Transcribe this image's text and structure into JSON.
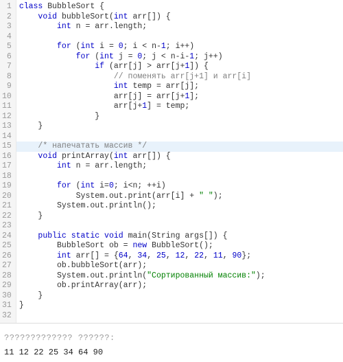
{
  "lines": [
    {
      "n": 1,
      "hl": false,
      "tokens": [
        [
          "",
          "class ",
          "kw"
        ],
        [
          "",
          "BubbleSort ",
          ""
        ],
        [
          "",
          "{",
          ""
        ]
      ]
    },
    {
      "n": 2,
      "hl": false,
      "tokens": [
        [
          "    ",
          "void ",
          "kw"
        ],
        [
          "",
          "bubbleSort",
          ""
        ],
        [
          "",
          "(",
          ""
        ],
        [
          "",
          "int ",
          "type"
        ],
        [
          "",
          "arr[]) {",
          ""
        ]
      ]
    },
    {
      "n": 3,
      "hl": false,
      "tokens": [
        [
          "        ",
          "int ",
          "type"
        ],
        [
          "",
          "n = arr.length;",
          ""
        ]
      ]
    },
    {
      "n": 4,
      "hl": false,
      "tokens": [
        [
          "",
          "",
          ""
        ]
      ]
    },
    {
      "n": 5,
      "hl": false,
      "tokens": [
        [
          "        ",
          "for ",
          "kw"
        ],
        [
          "",
          "(",
          ""
        ],
        [
          "",
          "int ",
          "type"
        ],
        [
          "",
          "i = ",
          ""
        ],
        [
          "",
          "0",
          "num"
        ],
        [
          "",
          "; i < n-",
          ""
        ],
        [
          "",
          "1",
          "num"
        ],
        [
          "",
          "; i++)",
          ""
        ]
      ]
    },
    {
      "n": 6,
      "hl": false,
      "tokens": [
        [
          "            ",
          "for ",
          "kw"
        ],
        [
          "",
          "(",
          ""
        ],
        [
          "",
          "int ",
          "type"
        ],
        [
          "",
          "j = ",
          ""
        ],
        [
          "",
          "0",
          "num"
        ],
        [
          "",
          "; j < n-i-",
          ""
        ],
        [
          "",
          "1",
          "num"
        ],
        [
          "",
          "; j++)",
          ""
        ]
      ]
    },
    {
      "n": 7,
      "hl": false,
      "tokens": [
        [
          "                ",
          "if ",
          "kw"
        ],
        [
          "",
          "(arr[j] > arr[j+",
          ""
        ],
        [
          "",
          "1",
          "num"
        ],
        [
          "",
          "]) {",
          ""
        ]
      ]
    },
    {
      "n": 8,
      "hl": false,
      "tokens": [
        [
          "                    ",
          "// поменять arr[j+1] и arr[i]",
          "com"
        ]
      ]
    },
    {
      "n": 9,
      "hl": false,
      "tokens": [
        [
          "                    ",
          "int ",
          "type"
        ],
        [
          "",
          "temp = arr[j];",
          ""
        ]
      ]
    },
    {
      "n": 10,
      "hl": false,
      "tokens": [
        [
          "                    ",
          "arr[j] = arr[j+",
          ""
        ],
        [
          "",
          "1",
          "num"
        ],
        [
          "",
          "];",
          ""
        ]
      ]
    },
    {
      "n": 11,
      "hl": false,
      "tokens": [
        [
          "                    ",
          "arr[j+",
          ""
        ],
        [
          "",
          "1",
          "num"
        ],
        [
          "",
          "] = temp;",
          ""
        ]
      ]
    },
    {
      "n": 12,
      "hl": false,
      "tokens": [
        [
          "                ",
          "}",
          ""
        ]
      ]
    },
    {
      "n": 13,
      "hl": false,
      "tokens": [
        [
          "    ",
          "}",
          ""
        ]
      ]
    },
    {
      "n": 14,
      "hl": false,
      "tokens": [
        [
          "",
          "",
          ""
        ]
      ]
    },
    {
      "n": 15,
      "hl": true,
      "tokens": [
        [
          "    ",
          "/* напечатать массив */",
          "com"
        ]
      ]
    },
    {
      "n": 16,
      "hl": false,
      "tokens": [
        [
          "    ",
          "void ",
          "kw"
        ],
        [
          "",
          "printArray",
          ""
        ],
        [
          "",
          "(",
          ""
        ],
        [
          "",
          "int ",
          "type"
        ],
        [
          "",
          "arr[]) {",
          ""
        ]
      ]
    },
    {
      "n": 17,
      "hl": false,
      "tokens": [
        [
          "        ",
          "int ",
          "type"
        ],
        [
          "",
          "n = arr.length;",
          ""
        ]
      ]
    },
    {
      "n": 18,
      "hl": false,
      "tokens": [
        [
          "",
          "",
          ""
        ]
      ]
    },
    {
      "n": 19,
      "hl": false,
      "tokens": [
        [
          "        ",
          "for ",
          "kw"
        ],
        [
          "",
          "(",
          ""
        ],
        [
          "",
          "int ",
          "type"
        ],
        [
          "",
          "i=",
          ""
        ],
        [
          "",
          "0",
          "num"
        ],
        [
          "",
          "; i<n; ++i)",
          ""
        ]
      ]
    },
    {
      "n": 20,
      "hl": false,
      "tokens": [
        [
          "            ",
          "System.out.print(arr[i] + ",
          ""
        ],
        [
          "",
          "\" \"",
          "str"
        ],
        [
          "",
          ");",
          ""
        ]
      ]
    },
    {
      "n": 21,
      "hl": false,
      "tokens": [
        [
          "        ",
          "System.out.println();",
          ""
        ]
      ]
    },
    {
      "n": 22,
      "hl": false,
      "tokens": [
        [
          "    ",
          "}",
          ""
        ]
      ]
    },
    {
      "n": 23,
      "hl": false,
      "tokens": [
        [
          "",
          "",
          ""
        ]
      ]
    },
    {
      "n": 24,
      "hl": false,
      "tokens": [
        [
          "    ",
          "public static ",
          "kw"
        ],
        [
          "",
          "void ",
          "kw"
        ],
        [
          "",
          "main",
          ""
        ],
        [
          "",
          "(String args[]) {",
          ""
        ]
      ]
    },
    {
      "n": 25,
      "hl": false,
      "tokens": [
        [
          "        ",
          "BubbleSort ob = ",
          ""
        ],
        [
          "",
          "new ",
          "kw"
        ],
        [
          "",
          "BubbleSort();",
          ""
        ]
      ]
    },
    {
      "n": 26,
      "hl": false,
      "tokens": [
        [
          "        ",
          "int ",
          "type"
        ],
        [
          "",
          "arr[] = {",
          ""
        ],
        [
          "",
          "64",
          "num"
        ],
        [
          "",
          ", ",
          ""
        ],
        [
          "",
          "34",
          "num"
        ],
        [
          "",
          ", ",
          ""
        ],
        [
          "",
          "25",
          "num"
        ],
        [
          "",
          ", ",
          ""
        ],
        [
          "",
          "12",
          "num"
        ],
        [
          "",
          ", ",
          ""
        ],
        [
          "",
          "22",
          "num"
        ],
        [
          "",
          ", ",
          ""
        ],
        [
          "",
          "11",
          "num"
        ],
        [
          "",
          ", ",
          ""
        ],
        [
          "",
          "90",
          "num"
        ],
        [
          "",
          "};",
          ""
        ]
      ]
    },
    {
      "n": 27,
      "hl": false,
      "tokens": [
        [
          "        ",
          "ob.bubbleSort(arr);",
          ""
        ]
      ]
    },
    {
      "n": 28,
      "hl": false,
      "tokens": [
        [
          "        ",
          "System.out.println(",
          ""
        ],
        [
          "",
          "\"Сортированный массив:\"",
          "str"
        ],
        [
          "",
          ");",
          ""
        ]
      ]
    },
    {
      "n": 29,
      "hl": false,
      "tokens": [
        [
          "        ",
          "ob.printArray(arr);",
          ""
        ]
      ]
    },
    {
      "n": 30,
      "hl": false,
      "tokens": [
        [
          "    ",
          "}",
          ""
        ]
      ]
    },
    {
      "n": 31,
      "hl": false,
      "tokens": [
        [
          "",
          "}",
          ""
        ]
      ]
    },
    {
      "n": 32,
      "hl": false,
      "tokens": [
        [
          "",
          "",
          ""
        ]
      ]
    }
  ],
  "output": {
    "header": "????????????? ??????:",
    "result": "11 12 22 25 34 64 90"
  }
}
